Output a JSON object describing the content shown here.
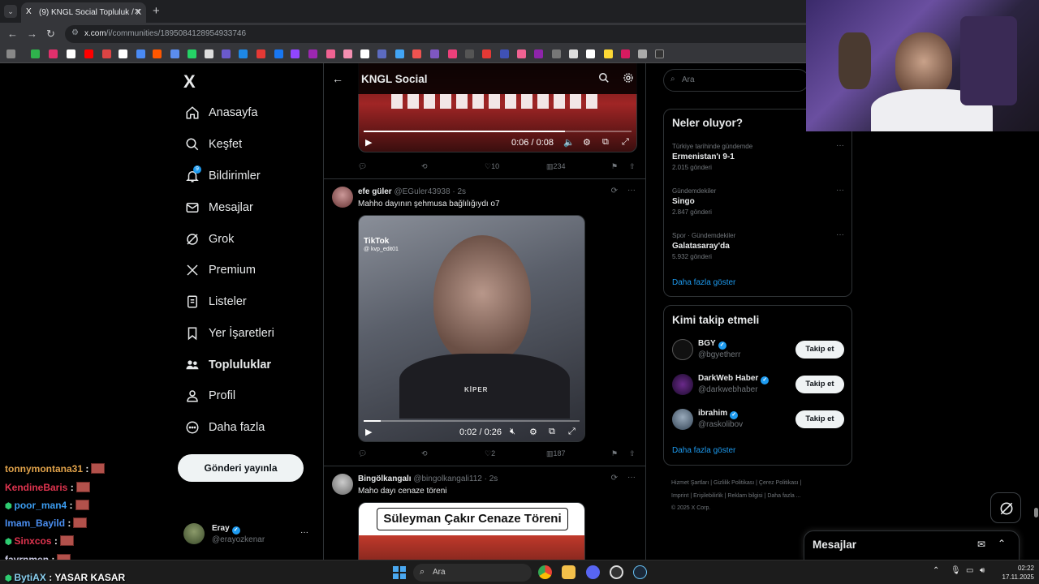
{
  "browser": {
    "tab_title": "(9) KNGL Social Topluluk / X",
    "tab_favicon": "X",
    "new_tab": "+",
    "url_host": "x.com",
    "url_path": "/i/communities/1895084128954933746"
  },
  "sidebar": {
    "logo": "X",
    "items": [
      {
        "label": "Anasayfa",
        "icon": "home-icon"
      },
      {
        "label": "Keşfet",
        "icon": "search-icon"
      },
      {
        "label": "Bildirimler",
        "icon": "bell-icon",
        "badge": "9"
      },
      {
        "label": "Mesajlar",
        "icon": "mail-icon"
      },
      {
        "label": "Grok",
        "icon": "grok-icon"
      },
      {
        "label": "Premium",
        "icon": "x-icon"
      },
      {
        "label": "Listeler",
        "icon": "list-icon"
      },
      {
        "label": "Yer İşaretleri",
        "icon": "bookmark-icon"
      },
      {
        "label": "Topluluklar",
        "icon": "communities-icon"
      },
      {
        "label": "Profil",
        "icon": "person-icon"
      },
      {
        "label": "Daha fazla",
        "icon": "more-circle-icon"
      }
    ],
    "post_button": "Gönderi yayınla",
    "account": {
      "name": "Eray",
      "handle": "@erayozkenar",
      "more": "···"
    }
  },
  "main": {
    "title": "KNGL Social",
    "posts": [
      {
        "video_time": "0:06 / 0:08",
        "video_progress": 0.75,
        "replies": "",
        "reposts": "",
        "likes": "10",
        "views": "234"
      },
      {
        "name": "efe güler",
        "handle": "@EGuler43938",
        "time": "· 2s",
        "text": "Mahho dayının şehmusa bağlılığıydı o7",
        "media_label_tiktok": "TikTok",
        "media_label_user": "@ kvp_edit01",
        "media_caption": "KİPER",
        "video_time": "0:02 / 0:26",
        "video_progress": 0.08,
        "likes": "2",
        "views": "187"
      },
      {
        "name": "Bingölkangalı",
        "handle": "@bingolkangali112",
        "time": "· 2s",
        "text": "Maho dayı cenaze töreni",
        "media_banner": "Süleyman Çakır Cenaze Töreni"
      }
    ]
  },
  "right": {
    "search_placeholder": "Ara",
    "trends_title": "Neler oluyor?",
    "trends": [
      {
        "context": "Türkiye tarihinde gündemde",
        "title": "Ermenistan'ı 9-1",
        "count": "2.015 gönderi"
      },
      {
        "context": "Gündemdekiler",
        "title": "Singo",
        "count": "2.847 gönderi"
      },
      {
        "context": "Spor · Gündemdekiler",
        "title": "Galatasaray'da",
        "count": "5.932 gönderi"
      }
    ],
    "trends_more": "Daha fazla göster",
    "who_title": "Kimi takip etmeli",
    "who": [
      {
        "name": "BGY",
        "handle": "@bgyetherr",
        "button": "Takip et"
      },
      {
        "name": "DarkWeb Haber",
        "handle": "@darkwebhaber",
        "button": "Takip et"
      },
      {
        "name": "ibrahim",
        "handle": "@raskolibov",
        "button": "Takip et"
      }
    ],
    "who_more": "Daha fazla göster",
    "footer": [
      "Hizmet Şartları",
      "Gizlilik Politikası",
      "Çerez Politikası",
      "Imprint",
      "Erişilebilirlik",
      "Reklam bilgisi",
      "Daha fazla ...",
      "© 2025 X Corp."
    ],
    "messages_title": "Mesajlar"
  },
  "chat": [
    {
      "user": "tonnymontana31",
      "color": "#e0a24a"
    },
    {
      "user": "KendineBaris",
      "color": "#e0344f"
    },
    {
      "user": "poor_man4",
      "color": "#3b9cf0"
    },
    {
      "user": "Imam_Bayild",
      "color": "#4a8ef0"
    },
    {
      "user": "Sinxcos",
      "color": "#e0344f"
    },
    {
      "user": "fayrnmen",
      "color": "#cfcfe8"
    },
    {
      "user": "BytiAX",
      "color": "#8ad0f0",
      "message": "YASAR KASAR"
    }
  ],
  "taskbar": {
    "search_placeholder": "Ara",
    "time": "02:22",
    "date": "17.11.2025"
  }
}
